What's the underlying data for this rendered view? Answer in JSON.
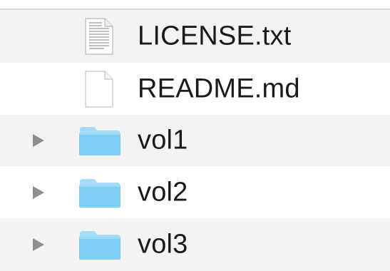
{
  "colors": {
    "stripe": "#f3f3f3",
    "divider": "#d6d6d6",
    "disclosure": "#8e8e8e",
    "folder_body": "#7fcdf3",
    "folder_tab": "#a4dcf6",
    "text": "#1a1a1a"
  },
  "file_list": {
    "items": [
      {
        "name": "LICENSE.txt",
        "kind": "file",
        "icon": "text-document-icon",
        "expandable": false
      },
      {
        "name": "README.md",
        "kind": "file",
        "icon": "blank-document-icon",
        "expandable": false
      },
      {
        "name": "vol1",
        "kind": "folder",
        "icon": "folder-icon",
        "expandable": true
      },
      {
        "name": "vol2",
        "kind": "folder",
        "icon": "folder-icon",
        "expandable": true
      },
      {
        "name": "vol3",
        "kind": "folder",
        "icon": "folder-icon",
        "expandable": true
      }
    ]
  }
}
